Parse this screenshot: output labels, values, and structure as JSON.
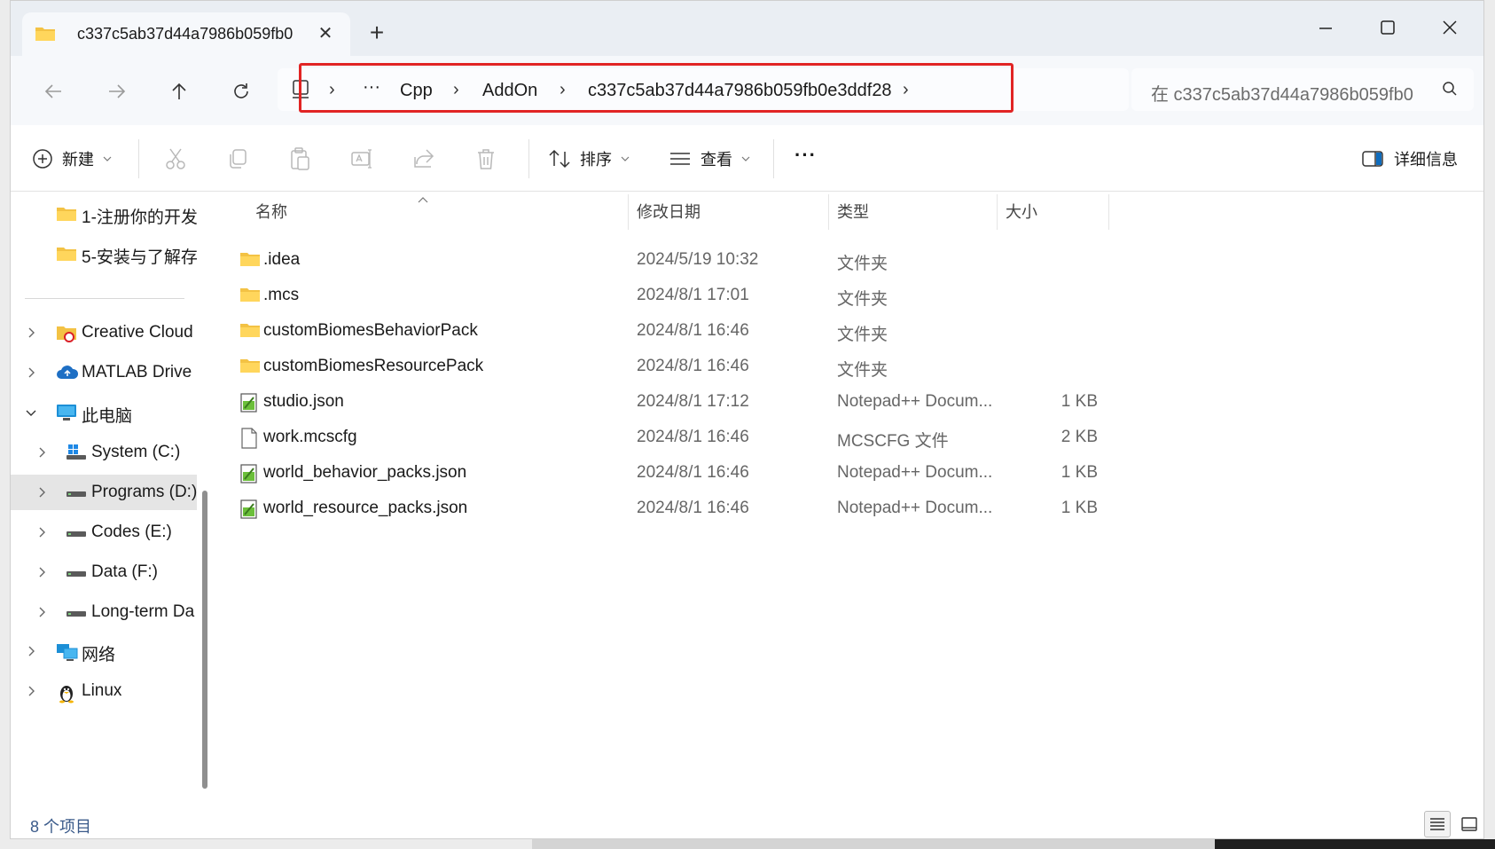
{
  "window": {
    "tab_title": "c337c5ab37d44a7986b059fb0",
    "tab_close_glyph": "✕",
    "new_tab_glyph": "+"
  },
  "address": {
    "breadcrumbs": [
      "Cpp",
      "AddOn",
      "c337c5ab37d44a7986b059fb0e3ddf28"
    ],
    "overflow_glyph": "···",
    "separator": "›",
    "highlight_color": "#e12424"
  },
  "search": {
    "placeholder": "在 c337c5ab37d44a7986b059fb0"
  },
  "toolbar": {
    "new_label": "新建",
    "sort_label": "排序",
    "view_label": "查看",
    "more_glyph": "···",
    "details_label": "详细信息"
  },
  "sidebar": {
    "quick_access": [
      {
        "label": "1-注册你的开发",
        "icon": "folder-icon"
      },
      {
        "label": "5-安装与了解存",
        "icon": "folder-icon"
      }
    ],
    "items": [
      {
        "label": "Creative Cloud",
        "icon": "creative-cloud-icon"
      },
      {
        "label": "MATLAB Drive",
        "icon": "cloud-icon"
      },
      {
        "label": "此电脑",
        "icon": "computer-icon"
      },
      {
        "label": "System (C:)",
        "icon": "windows-drive-icon"
      },
      {
        "label": "Programs (D:)",
        "icon": "drive-icon"
      },
      {
        "label": "Codes (E:)",
        "icon": "drive-icon"
      },
      {
        "label": "Data (F:)",
        "icon": "drive-icon"
      },
      {
        "label": "Long-term Da",
        "icon": "drive-icon"
      },
      {
        "label": "网络",
        "icon": "network-icon"
      },
      {
        "label": "Linux",
        "icon": "linux-icon"
      }
    ]
  },
  "columns": {
    "name": "名称",
    "date": "修改日期",
    "type": "类型",
    "size": "大小"
  },
  "files": [
    {
      "name": ".idea",
      "date": "2024/5/19 10:32",
      "type": "文件夹",
      "size": "",
      "icon": "folder-icon"
    },
    {
      "name": ".mcs",
      "date": "2024/8/1 17:01",
      "type": "文件夹",
      "size": "",
      "icon": "folder-icon"
    },
    {
      "name": "customBiomesBehaviorPack",
      "date": "2024/8/1 16:46",
      "type": "文件夹",
      "size": "",
      "icon": "folder-icon"
    },
    {
      "name": "customBiomesResourcePack",
      "date": "2024/8/1 16:46",
      "type": "文件夹",
      "size": "",
      "icon": "folder-icon"
    },
    {
      "name": "studio.json",
      "date": "2024/8/1 17:12",
      "type": "Notepad++ Docum...",
      "size": "1 KB",
      "icon": "notepadpp-file-icon"
    },
    {
      "name": "work.mcscfg",
      "date": "2024/8/1 16:46",
      "type": "MCSCFG 文件",
      "size": "2 KB",
      "icon": "blank-file-icon"
    },
    {
      "name": "world_behavior_packs.json",
      "date": "2024/8/1 16:46",
      "type": "Notepad++ Docum...",
      "size": "1 KB",
      "icon": "notepadpp-file-icon"
    },
    {
      "name": "world_resource_packs.json",
      "date": "2024/8/1 16:46",
      "type": "Notepad++ Docum...",
      "size": "1 KB",
      "icon": "notepadpp-file-icon"
    }
  ],
  "status": {
    "item_count": "8 个项目"
  }
}
